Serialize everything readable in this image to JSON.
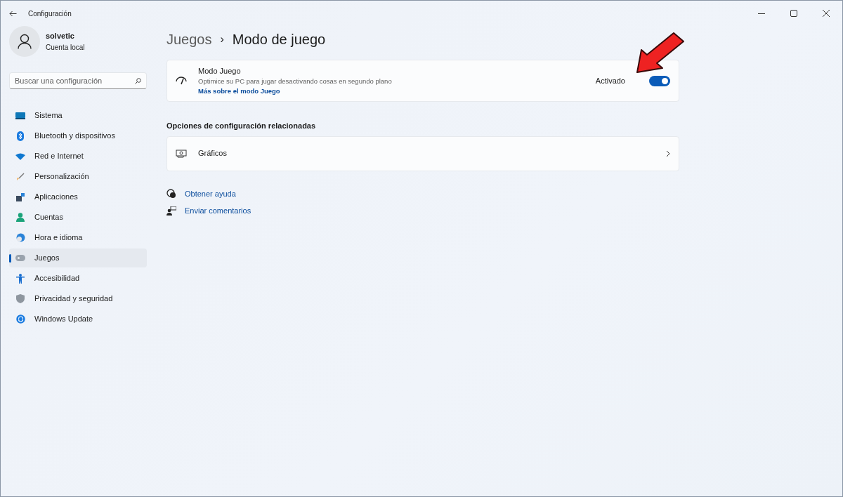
{
  "window": {
    "title": "Configuración"
  },
  "account": {
    "name": "solvetic",
    "type": "Cuenta local"
  },
  "search": {
    "placeholder": "Buscar una configuración"
  },
  "sidebar": {
    "items": [
      {
        "label": "Sistema",
        "selected": false
      },
      {
        "label": "Bluetooth y dispositivos",
        "selected": false
      },
      {
        "label": "Red e Internet",
        "selected": false
      },
      {
        "label": "Personalización",
        "selected": false
      },
      {
        "label": "Aplicaciones",
        "selected": false
      },
      {
        "label": "Cuentas",
        "selected": false
      },
      {
        "label": "Hora e idioma",
        "selected": false
      },
      {
        "label": "Juegos",
        "selected": true
      },
      {
        "label": "Accesibilidad",
        "selected": false
      },
      {
        "label": "Privacidad y seguridad",
        "selected": false
      },
      {
        "label": "Windows Update",
        "selected": false
      }
    ]
  },
  "breadcrumb": {
    "parent": "Juegos",
    "separator": "›",
    "current": "Modo de juego"
  },
  "game_mode": {
    "title": "Modo Juego",
    "description": "Optimice su PC para jugar desactivando cosas en segundo plano",
    "link": "Más sobre el modo Juego",
    "state_label": "Activado",
    "on": true
  },
  "related": {
    "heading": "Opciones de configuración relacionadas",
    "items": [
      {
        "label": "Gráficos"
      }
    ]
  },
  "help_links": [
    "Obtener ayuda",
    "Enviar comentarios"
  ]
}
